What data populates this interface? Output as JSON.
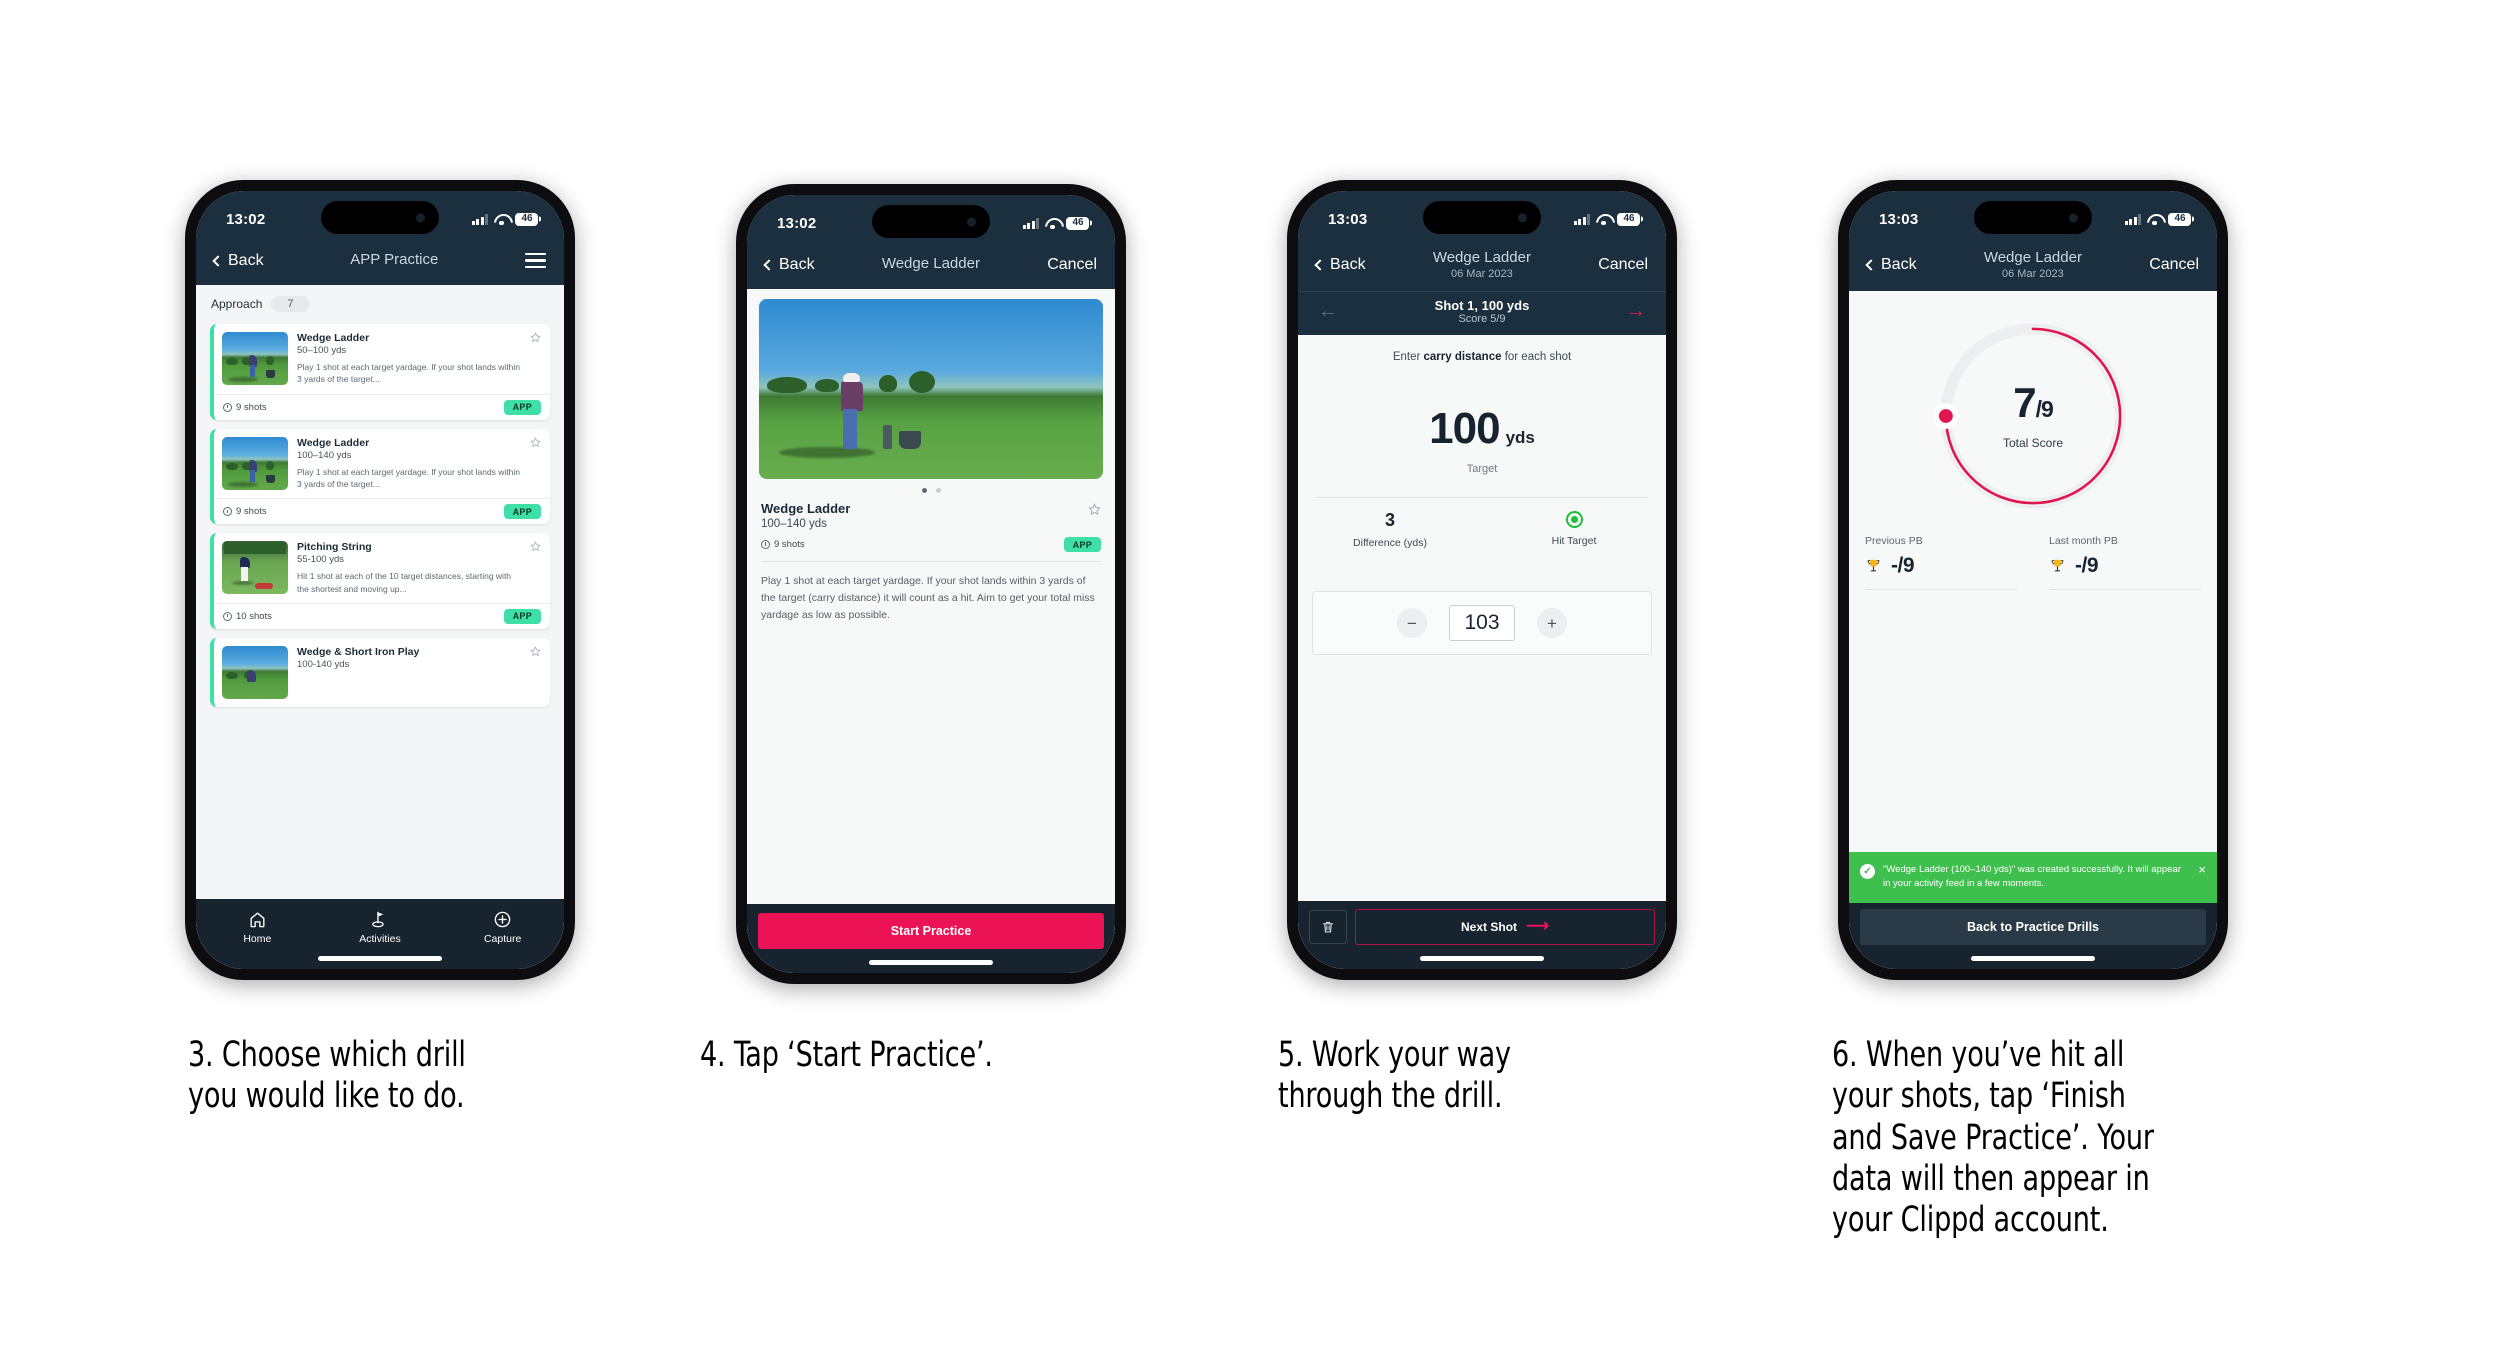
{
  "accent": {
    "navy": "#1b2f3f",
    "dark": "#17242f",
    "mint": "#3ee0a8",
    "crimson": "#ec1256",
    "green": "#3fbf4e",
    "trophy": "#f4b41a"
  },
  "phone1": {
    "statusbar": {
      "time": "13:02",
      "battery": "46"
    },
    "navbar": {
      "back": "Back",
      "title": "APP Practice",
      "menu_icon": "hamburger-icon"
    },
    "section": {
      "label": "Approach",
      "count": "7"
    },
    "cards": [
      {
        "title": "Wedge Ladder",
        "yards": "50–100 yds",
        "desc": "Play 1 shot at each target yardage. If your shot lands within 3 yards of the target...",
        "shots": "9 shots",
        "badge": "APP"
      },
      {
        "title": "Wedge Ladder",
        "yards": "100–140 yds",
        "desc": "Play 1 shot at each target yardage. If your shot lands within 3 yards of the target...",
        "shots": "9 shots",
        "badge": "APP"
      },
      {
        "title": "Pitching String",
        "yards": "55-100 yds",
        "desc": "Hit 1 shot at each of the 10 target distances, starting with the shortest and moving up...",
        "shots": "10 shots",
        "badge": "APP"
      },
      {
        "title": "Wedge & Short Iron Play",
        "yards": "100-140 yds",
        "desc": "",
        "shots": "",
        "badge": ""
      }
    ],
    "tabs": [
      {
        "label": "Home",
        "icon": "home-icon"
      },
      {
        "label": "Activities",
        "icon": "golf-flag-icon"
      },
      {
        "label": "Capture",
        "icon": "plus-circle-icon"
      }
    ]
  },
  "phone2": {
    "statusbar": {
      "time": "13:02",
      "battery": "46"
    },
    "navbar": {
      "back": "Back",
      "title": "Wedge Ladder",
      "cancel": "Cancel"
    },
    "detail": {
      "title": "Wedge Ladder",
      "yards": "100–140 yds",
      "shots": "9 shots",
      "badge": "APP",
      "description": "Play 1 shot at each target yardage. If your shot lands within 3 yards of the target (carry distance) it will count as a hit. Aim to get your total miss yardage as low as possible."
    },
    "cta": "Start Practice"
  },
  "phone3": {
    "statusbar": {
      "time": "13:03",
      "battery": "46"
    },
    "navbar": {
      "back": "Back",
      "title": "Wedge Ladder",
      "subtitle": "06 Mar 2023",
      "cancel": "Cancel"
    },
    "subnav": {
      "shot": "Shot 1, 100 yds",
      "score": "Score 5/9"
    },
    "prompt_pre": "Enter ",
    "prompt_bold": "carry distance",
    "prompt_post": " for each shot",
    "target": {
      "value": "100",
      "unit": "yds",
      "caption": "Target"
    },
    "stats": [
      {
        "value": "3",
        "label": "Difference (yds)"
      },
      {
        "value": "",
        "label": "Hit Target"
      }
    ],
    "stepper": {
      "minus": "−",
      "value": "103",
      "plus": "+"
    },
    "footer": {
      "delete_icon": "trash-icon",
      "next": "Next Shot"
    }
  },
  "phone4": {
    "statusbar": {
      "time": "13:03",
      "battery": "46"
    },
    "navbar": {
      "back": "Back",
      "title": "Wedge Ladder",
      "subtitle": "06 Mar 2023",
      "cancel": "Cancel"
    },
    "gauge": {
      "score": "7",
      "separator": "/",
      "denominator": "9",
      "label": "Total Score"
    },
    "pbs": [
      {
        "label": "Previous PB",
        "value": "-/9"
      },
      {
        "label": "Last month PB",
        "value": "-/9"
      }
    ],
    "toast": {
      "message": "\"Wedge Ladder (100–140 yds)\" was created successfully. It will appear in your activity feed in a few moments.",
      "check": "✓",
      "close": "×"
    },
    "cta": "Back to Practice Drills"
  },
  "captions": [
    "3. Choose which drill you would like to do.",
    "4. Tap ‘Start Practice’.",
    "5. Work your way through the drill.",
    "6. When you’ve hit all your shots, tap ‘Finish and Save Practice’. Your data will then appear in your Clippd account."
  ]
}
